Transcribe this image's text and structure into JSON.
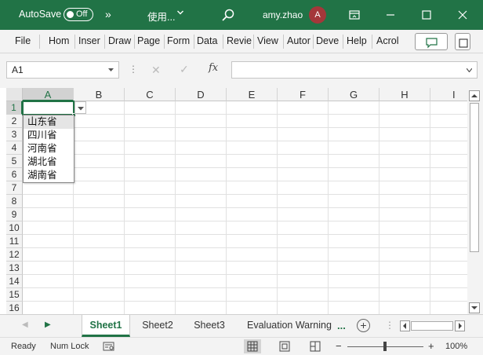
{
  "title_bar": {
    "autosave_label": "AutoSave",
    "autosave_state": "Off",
    "more_chevron": "»",
    "document_name": "使用...",
    "user_name": "amy.zhao",
    "avatar_initial": "A",
    "accent_color": "#217346"
  },
  "ribbon": {
    "tabs": [
      "File",
      "Hom",
      "Inser",
      "Draw",
      "Page",
      "Form",
      "Data",
      "Revie",
      "View",
      "Autor",
      "Deve",
      "Help",
      "Acrol"
    ]
  },
  "formula_bar": {
    "name_box": "A1",
    "fx_label": "fx",
    "formula": ""
  },
  "grid": {
    "columns": [
      "A",
      "B",
      "C",
      "D",
      "E",
      "F",
      "G",
      "H",
      "I"
    ],
    "rows": [
      "1",
      "2",
      "3",
      "4",
      "5",
      "6",
      "7",
      "8",
      "9",
      "10",
      "11",
      "12",
      "13",
      "14",
      "15",
      "16"
    ],
    "selected_cell": "A1"
  },
  "dropdown": {
    "options": [
      "山东省",
      "四川省",
      "河南省",
      "湖北省",
      "湖南省"
    ],
    "highlighted": "山东省"
  },
  "sheets": {
    "tabs": [
      "Sheet1",
      "Sheet2",
      "Sheet3",
      "Evaluation Warning"
    ],
    "active": "Sheet1",
    "more": "...",
    "add": "+"
  },
  "status_bar": {
    "ready": "Ready",
    "num_lock": "Num Lock",
    "zoom_minus": "−",
    "zoom_plus": "+",
    "zoom_level": "100%"
  }
}
